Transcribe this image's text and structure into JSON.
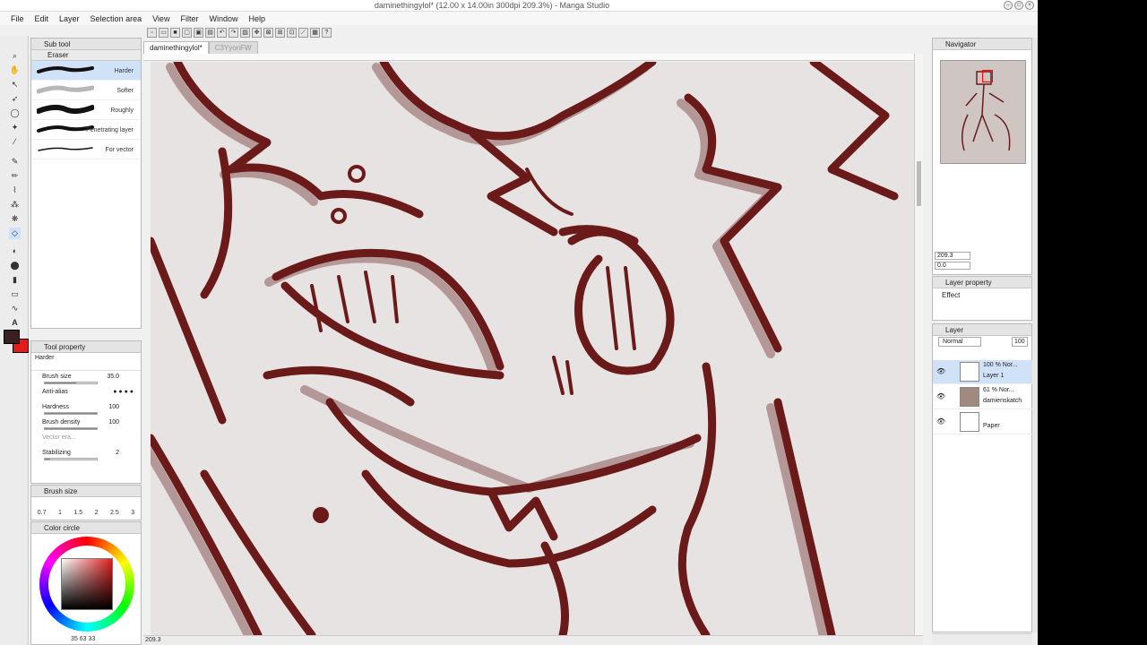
{
  "window": {
    "title": "daminethingylol* (12.00 x 14.00in 300dpi 209.3%) - Manga Studio"
  },
  "menu": [
    "File",
    "Edit",
    "Layer",
    "Selection area",
    "View",
    "Filter",
    "Window",
    "Help"
  ],
  "subtool": {
    "header": "Sub tool",
    "group": "Eraser",
    "items": [
      {
        "label": "Harder",
        "selected": true
      },
      {
        "label": "Softer",
        "selected": false
      },
      {
        "label": "Roughly",
        "selected": false
      },
      {
        "label": "Penetrating layer",
        "selected": false
      },
      {
        "label": "For vector",
        "selected": false
      }
    ]
  },
  "tool_property": {
    "header": "Tool property",
    "preview_label": "Harder",
    "brush_size_label": "Brush size",
    "brush_size_value": "35.0",
    "antialias_label": "Anti-alias",
    "hardness_label": "Hardness",
    "hardness_value": "100",
    "brush_density_label": "Brush density",
    "brush_density_value": "100",
    "vector_label": "Vector era...",
    "stabilizing_label": "Stabilizing",
    "stabilizing_value": "2"
  },
  "brush_size_panel": {
    "header": "Brush size",
    "sizes": [
      "0.7",
      "1",
      "1.5",
      "2",
      "2.5",
      "3"
    ]
  },
  "color_circle": {
    "header": "Color circle",
    "readout": "35   63   33",
    "main_color": "#3a2020",
    "sub_color": "#e31b1b"
  },
  "document": {
    "tabs": [
      {
        "label": "daminethingylol*",
        "active": true
      },
      {
        "label": "C3YyonFW",
        "active": false
      }
    ],
    "status_zoom": "209.3"
  },
  "navigator": {
    "header": "Navigator",
    "zoom": "209.3",
    "rotation": "0.0"
  },
  "layer_property": {
    "header": "Layer property",
    "effect_label": "Effect"
  },
  "layers": {
    "header": "Layer",
    "blend_mode": "Normal",
    "opacity": "100",
    "items": [
      {
        "opacity": "100 %  Nor...",
        "name": "Layer 1",
        "selected": true
      },
      {
        "opacity": "61 %  Nor...",
        "name": "damienskatch",
        "selected": false
      },
      {
        "opacity": "",
        "name": "Paper",
        "selected": false
      }
    ]
  },
  "colors": {
    "ink": "#6b1a1a",
    "ink_shadow": "#a88585",
    "paper": "#e7e3e2"
  }
}
